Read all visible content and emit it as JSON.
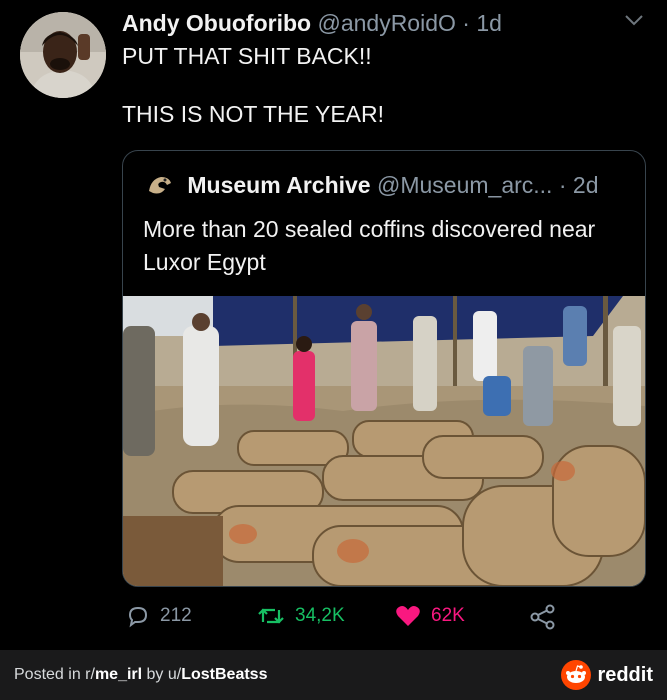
{
  "tweet": {
    "author_name": "Andy Obuoforibo",
    "handle": "@andyRoidO",
    "separator": "·",
    "time": "1d",
    "lines": [
      "PUT THAT SHIT BACK!!",
      "THIS IS NOT THE YEAR!"
    ]
  },
  "quoted": {
    "author_name": "Museum Archive",
    "handle": "@Museum_arc...",
    "separator": "·",
    "time": "2d",
    "text": "More than 20 sealed coffins discovered near Luxor Egypt"
  },
  "actions": {
    "replies": "212",
    "retweets": "34,2K",
    "likes": "62K"
  },
  "footer": {
    "prefix": "Posted in r/",
    "subreddit": "me_irl",
    "by": " by u/",
    "user": "LostBeatss",
    "brand": "reddit"
  },
  "colors": {
    "retweet": "#17bf63",
    "like": "#f91880",
    "muted": "#8b98a5",
    "reddit_orange": "#ff4500"
  }
}
